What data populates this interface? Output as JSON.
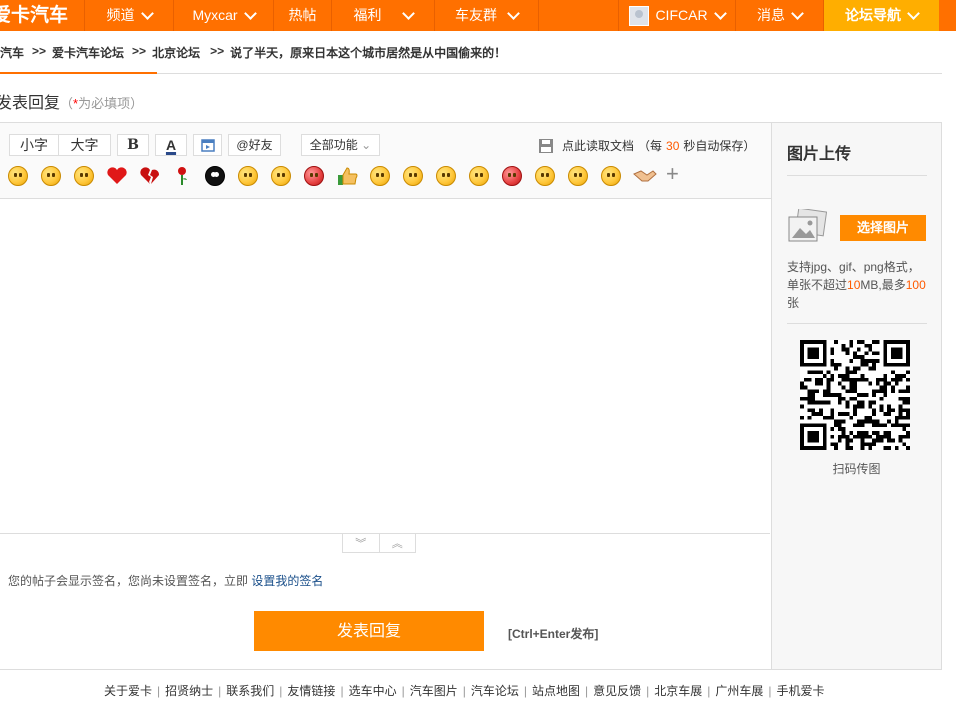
{
  "header": {
    "logo": "爱卡汽车",
    "nav": [
      {
        "label": "频道",
        "chevron": true
      },
      {
        "label": "Myxcar",
        "chevron": true
      },
      {
        "label": "热帖",
        "chevron": false
      },
      {
        "label": "福利",
        "chevron": true
      },
      {
        "label": "车友群",
        "chevron": true
      }
    ],
    "user": "CIFCAR",
    "messages": "消息",
    "guide": "论坛导航"
  },
  "breadcrumb": {
    "items": [
      "爱卡汽车",
      "爱卡汽车论坛",
      "北京论坛",
      "说了半天，原来日本这个城市居然是从中国偷来的！"
    ],
    "separator": ">>"
  },
  "form": {
    "title": "发表回复",
    "required_open": "（",
    "required_star": "*",
    "required_text": "为必填项）"
  },
  "toolbar": {
    "small_font": "小字",
    "large_font": "大字",
    "bold": "B",
    "font_color": "A",
    "at_friend": "@好友",
    "all_features": "全部功能",
    "read_doc": "点此读取文档",
    "autosave_prefix": "（每",
    "autosave_seconds": "30",
    "autosave_suffix": "秒自动保存）"
  },
  "emoticons": [
    "smile",
    "cry",
    "sob",
    "heart",
    "broken-heart",
    "rose",
    "black-face",
    "tongue",
    "shy",
    "angry",
    "thumbs-up",
    "sweat",
    "grin",
    "sneeze",
    "cool",
    "mad",
    "sleepy",
    "wink",
    "dizzy",
    "handshake",
    "more"
  ],
  "signature": {
    "text": "您的帖子会显示签名，您尚未设置签名，立即",
    "link": "设置我的签名"
  },
  "submit": {
    "label": "发表回复",
    "shortcut": "[Ctrl+Enter发布]"
  },
  "sidebar": {
    "title": "图片上传",
    "choose": "选择图片",
    "desc_1": "支持jpg、gif、png格式，单张不超过",
    "size": "10",
    "desc_2": "MB,最多",
    "max": "100",
    "desc_3": "张",
    "qr_caption": "扫码传图"
  },
  "footer": [
    "关于爱卡",
    "招贤纳士",
    "联系我们",
    "友情链接",
    "选车中心",
    "汽车图片",
    "汽车论坛",
    "站点地图",
    "意见反馈",
    "北京车展",
    "广州车展",
    "手机爱卡"
  ]
}
